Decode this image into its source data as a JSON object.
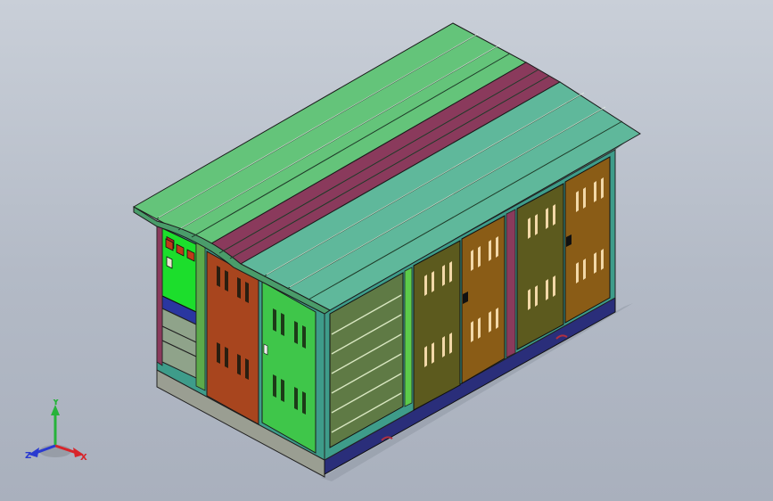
{
  "viewport": {
    "background_top": "#c9cfd8",
    "background_bottom": "#a9b0bd"
  },
  "colors": {
    "roof_green": "#64c47a",
    "roof_teal": "#5fb89b",
    "roof_maroon": "#8a3a5c",
    "panel_green": "#3fc64a",
    "panel_rust": "#a8451e",
    "door_olive": "#5c5a1e",
    "door_ochre": "#8a5c16",
    "wall_teal": "#3e9c8a",
    "louver_panel": "#5f7a45",
    "base_navy": "#2a2e7a",
    "base_gray": "#9a9e92",
    "control_green": "#1cde2c",
    "control_blue": "#2a36a0"
  },
  "icons": [
    "meter-icon",
    "louver-vent-icon",
    "door-handle-icon",
    "axis-triad-icon"
  ],
  "triad": {
    "x_label": "X",
    "y_label": "Y",
    "z_label": "Z",
    "x_color": "#d8242a",
    "y_color": "#26b33a",
    "z_color": "#2a3ad0"
  }
}
